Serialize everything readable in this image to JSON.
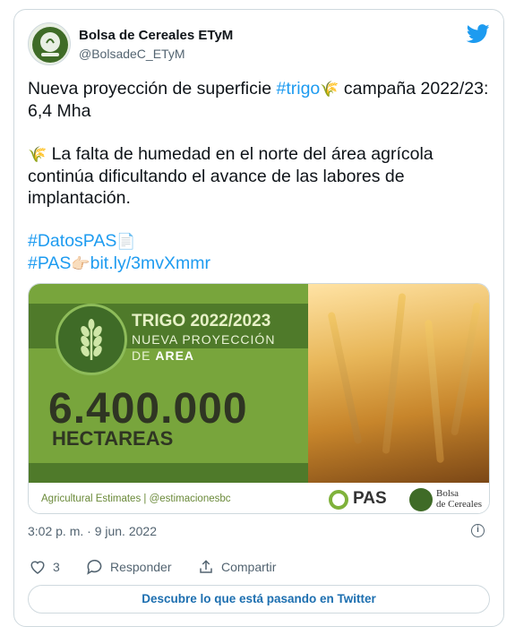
{
  "tweet": {
    "author_name": "Bolsa de Cereales ETyM",
    "author_handle": "@BolsadeC_ETyM",
    "text_line1": "Nueva proyección de superficie ",
    "hashtag_trigo": "#trigo",
    "text_line1_rest": " campaña 2022/23: 6,4 Mha",
    "text_para2": " La falta de humedad en el norte del área agrícola continúa dificultando el avance de las labores de implantación.",
    "hashtag_datospas": "#DatosPAS",
    "hashtag_pas": "#PAS",
    "link": "bit.ly/3mvXmmr",
    "timestamp": "3:02 p. m. · 9 jun. 2022",
    "likes_count": "3",
    "reply_label": "Responder",
    "share_label": "Compartir",
    "cta_label": "Descubre lo que está pasando en Twitter"
  },
  "media": {
    "title": "TRIGO 2022/2023",
    "subtitle_line1": "NUEVA PROYECCIÓN",
    "subtitle_line2_prefix": "DE ",
    "subtitle_line2_bold": "AREA",
    "figure": "6.400.000",
    "unit": "HECTAREAS",
    "footer_text": "Agricultural Estimates | @estimacionesbc",
    "pas_logo_text": "PAS",
    "bolsa_logo_line1": "Bolsa",
    "bolsa_logo_line2": "de Cereales"
  },
  "colors": {
    "twitter_blue": "#1d9bf0",
    "panel_green": "#78a53c",
    "dark_green": "#4f7a2a"
  },
  "icons": {
    "brand": "twitter-bird-icon",
    "wheat": "wheat-emoji-icon",
    "document": "document-emoji-icon",
    "pointing": "pointing-hand-emoji-icon",
    "info": "info-icon",
    "like": "heart-icon",
    "reply": "reply-bubble-icon",
    "share": "share-icon"
  }
}
